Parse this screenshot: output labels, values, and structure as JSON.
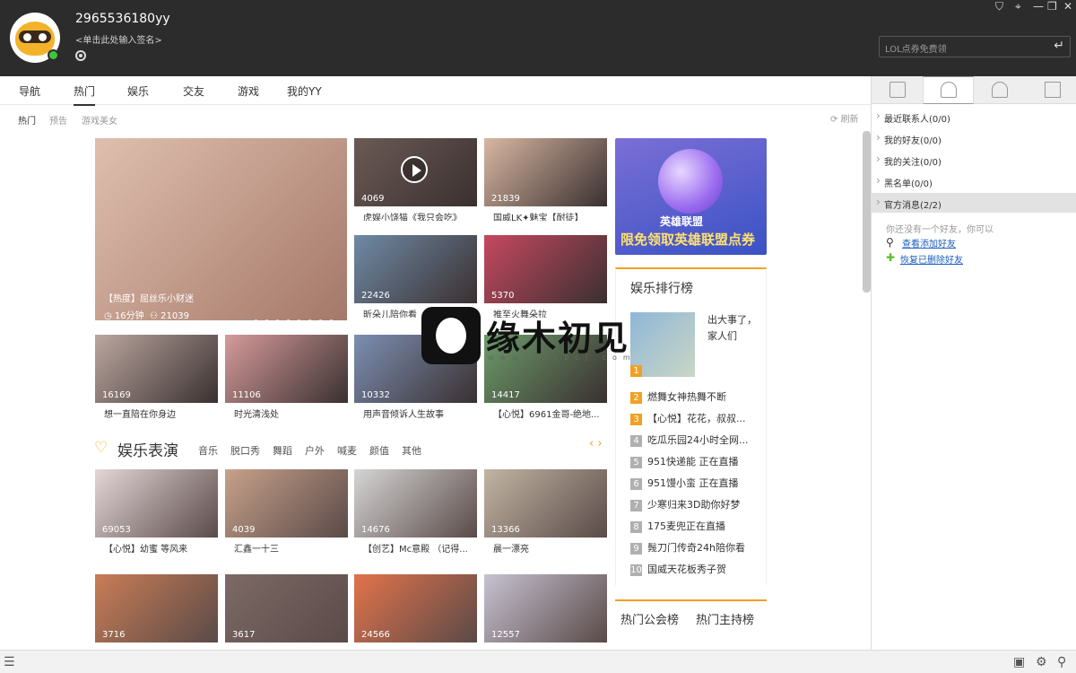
{
  "header": {
    "username": "2965536180yy",
    "signature": "<单击此处输入签名>",
    "search_placeholder": "LOL点券免费领",
    "enter_glyph": "↵",
    "window_controls": [
      "⛉",
      "⌖",
      "—",
      "❐",
      "✕"
    ]
  },
  "nav": {
    "tabs": [
      "导航",
      "热门",
      "娱乐",
      "交友",
      "游戏",
      "我的YY"
    ],
    "active": "热门"
  },
  "subnav": {
    "items": [
      "热门",
      "预告",
      "游戏美女"
    ],
    "refresh": "刷新"
  },
  "featured": {
    "caption": "【热度】屈丝乐小财迷",
    "duration": "16分钟",
    "viewers": "21039"
  },
  "hot_grid": [
    {
      "count": "4069",
      "caption": "虎娱小饶猫《我只会吃》",
      "color": "#6b5a55"
    },
    {
      "count": "21839",
      "caption": "国威LK✦魅宝【耐徒】",
      "color": "#d9b7a2"
    },
    {
      "count": "22426",
      "caption": "昕朵儿陪你看",
      "color": "#6f8aa6"
    },
    {
      "count": "5370",
      "caption": "推至火舞朵拉",
      "color": "#c64860"
    },
    {
      "count": "16169",
      "caption": "想一直陪在你身边",
      "color": "#bba79f"
    },
    {
      "count": "11106",
      "caption": "时光清浅处",
      "color": "#d69b9b"
    },
    {
      "count": "10332",
      "caption": "用声音倾诉人生故事",
      "color": "#7c8fb3"
    },
    {
      "count": "14417",
      "caption": "【心悦】6961金哥-绝地...",
      "color": "#6c9b6a"
    }
  ],
  "entertainment": {
    "title": "娱乐表演",
    "categories": [
      "音乐",
      "脱口秀",
      "舞蹈",
      "户外",
      "喊麦",
      "颜值",
      "其他"
    ],
    "cards": [
      {
        "count": "69053",
        "caption": "【心悦】幼蜜 等风来",
        "color": "#e4d6d8"
      },
      {
        "count": "4039",
        "caption": "汇鑫一十三",
        "color": "#c7a18a"
      },
      {
        "count": "14676",
        "caption": "【创艺】Mc意殿 （记得...",
        "color": "#d5d5d5"
      },
      {
        "count": "13366",
        "caption": "晨一漂亮",
        "color": "#c2b5a3"
      },
      {
        "count": "3716",
        "caption": "",
        "color": "#c97d56"
      },
      {
        "count": "3617",
        "caption": "",
        "color": "#7d6a66"
      },
      {
        "count": "24566",
        "caption": "",
        "color": "#e2734b"
      },
      {
        "count": "12557",
        "caption": "",
        "color": "#c7c2d2"
      }
    ]
  },
  "promo": {
    "line1": "英雄联盟",
    "line2": "限免领取英雄联盟点券"
  },
  "ranking": {
    "title": "娱乐排行榜",
    "first": "出大事了，家人们",
    "items": [
      "燃舞女神热舞不断",
      "【心悦】花花，叔叔...",
      "吃瓜乐园24小时全网...",
      "951快递能 正在直播",
      "951馒小蛮 正在直播",
      "少寒归来3D助你好梦",
      "175麦兜正在直播",
      "䯷刀门传奇24h陪你看",
      "国威天花板秀子贺"
    ]
  },
  "hot_tabs": [
    "热门公会榜",
    "热门主持榜"
  ],
  "watermark": {
    "text": "缘木初见",
    "sub": "www.52ybcj.com"
  },
  "sidebar": {
    "items": [
      "最近联系人(0/0)",
      "我的好友(0/0)",
      "我的关注(0/0)",
      "黑名单(0/0)",
      "官方消息(2/2)"
    ],
    "tip": "你还没有一个好友，你可以",
    "link_add": "查看添加好友",
    "link_restore": "恢复已删除好友"
  },
  "bottom": {
    "menu": "☰"
  }
}
